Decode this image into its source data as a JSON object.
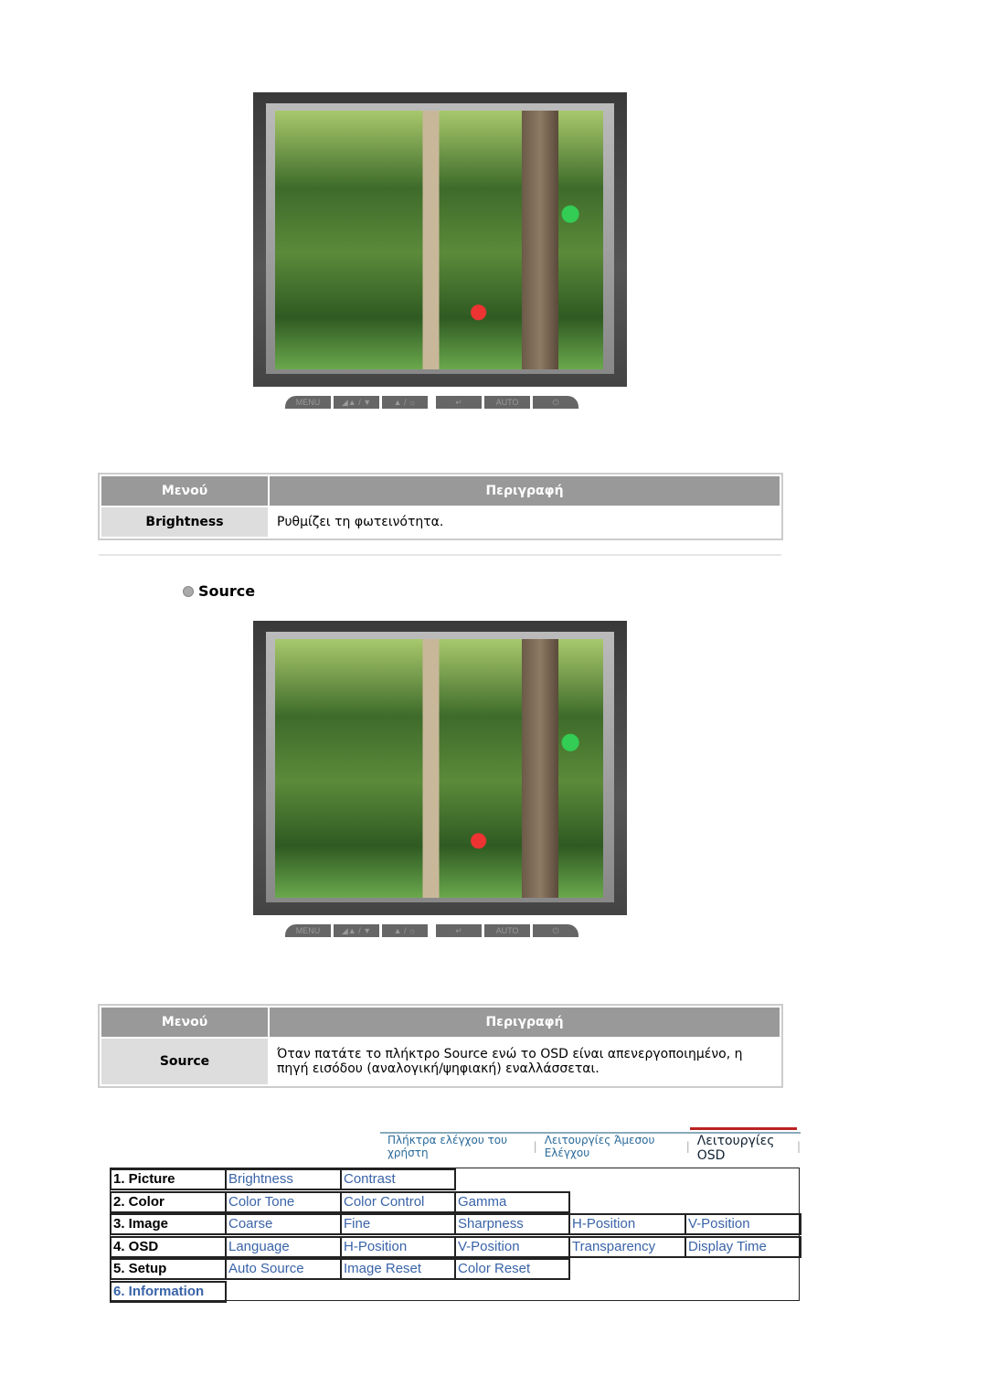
{
  "monitor_buttons": [
    "MENU",
    "◢▲ / ▼",
    "▲ / ☼",
    "↵",
    "AUTO",
    "⏻"
  ],
  "table1": {
    "headers": [
      "Μενού",
      "Περιγραφή"
    ],
    "rows": [
      {
        "menu": "Brightness",
        "desc": "Ρυθμίζει τη φωτεινότητα."
      }
    ]
  },
  "section": {
    "title": "Source"
  },
  "table2": {
    "headers": [
      "Μενού",
      "Περιγραφή"
    ],
    "rows": [
      {
        "menu": "Source",
        "desc": "Όταν πατάτε το πλήκτρο Source ενώ το OSD είναι απενεργοποιημένο, η πηγή εισόδου (αναλογική/ψηφιακή) εναλλάσσεται."
      }
    ]
  },
  "nav": {
    "items": [
      "Πλήκτρα ελέγχου του χρήστη",
      "Λειτουργίες Άμεσου Ελέγχου",
      "Λειτουργίες OSD"
    ],
    "active": "Λειτουργίες OSD"
  },
  "osd_menu": [
    {
      "label": "1. Picture",
      "items": [
        "Brightness",
        "Contrast"
      ]
    },
    {
      "label": "2. Color",
      "items": [
        "Color Tone",
        "Color Control",
        "Gamma"
      ]
    },
    {
      "label": "3. Image",
      "items": [
        "Coarse",
        "Fine",
        "Sharpness",
        "H-Position",
        "V-Position"
      ]
    },
    {
      "label": "4. OSD",
      "items": [
        "Language",
        "H-Position",
        "V-Position",
        "Transparency",
        "Display Time"
      ]
    },
    {
      "label": "5. Setup",
      "items": [
        "Auto Source",
        "Image Reset",
        "Color Reset"
      ]
    },
    {
      "label": "6. Information",
      "items": []
    }
  ],
  "colors": {
    "link": "#3a64a8",
    "header_bg": "#999999",
    "menu_cell_bg": "#dddddd",
    "nav_active": "#b22222"
  }
}
